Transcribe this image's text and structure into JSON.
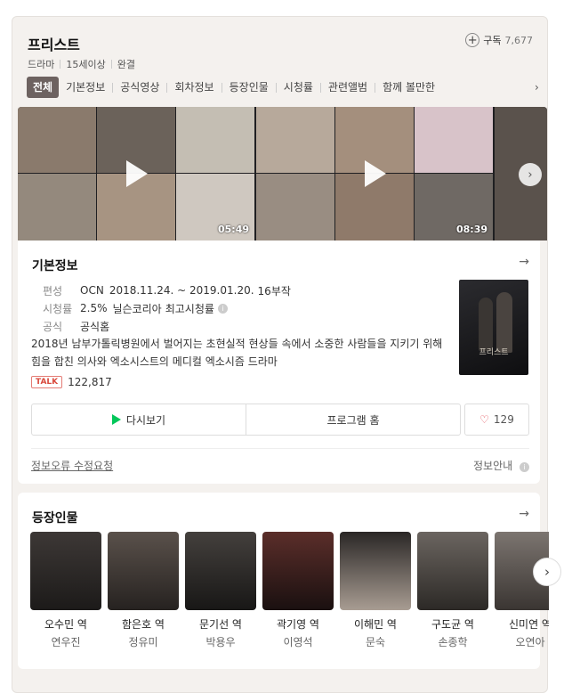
{
  "header": {
    "title": "프리스트",
    "subscribe_label": "구독",
    "subscribe_count": "7,677",
    "meta": [
      "드라마",
      "15세이상",
      "완결"
    ]
  },
  "tabs": [
    "전체",
    "기본정보",
    "공식영상",
    "회차정보",
    "등장인물",
    "시청률",
    "관련앨범",
    "함께 볼만한"
  ],
  "videos": [
    {
      "duration": "05:49"
    },
    {
      "duration": "08:39"
    }
  ],
  "basic_info": {
    "section_title": "기본정보",
    "rows": {
      "schedule_label": "편성",
      "channel": "OCN",
      "period": "2018.11.24. ~ 2019.01.20.",
      "episodes": "16부작",
      "rating_label": "시청률",
      "rating_value": "2.5%",
      "rating_source": "닐슨코리아",
      "rating_desc": "최고시청률",
      "official_label": "공식",
      "official_link": "공식홈"
    },
    "description": "2018년 남부가톨릭병원에서 벌어지는 초현실적 현상들 속에서 소중한 사람들을 지키기 위해 힘을 합친 의사와 엑소시스트의 메디컬 엑소시즘 드라마",
    "talk_badge": "TALK",
    "talk_count": "122,817",
    "buttons": {
      "watch": "다시보기",
      "home": "프로그램 홈",
      "like_count": "129"
    },
    "footer": {
      "error_report": "정보오류 수정요청",
      "info_guide": "정보안내"
    },
    "poster_title": "프리스트"
  },
  "cast": {
    "section_title": "등장인물",
    "members": [
      {
        "role": "오수민 역",
        "actor": "연우진"
      },
      {
        "role": "함은호 역",
        "actor": "정유미"
      },
      {
        "role": "문기선 역",
        "actor": "박용우"
      },
      {
        "role": "곽기영 역",
        "actor": "이영석"
      },
      {
        "role": "이해민 역",
        "actor": "문숙"
      },
      {
        "role": "구도균 역",
        "actor": "손종학"
      },
      {
        "role": "신미연 역",
        "actor": "오연아"
      }
    ]
  },
  "colors": {
    "active_tab": "#6d6260",
    "accent_green": "#03a94d",
    "link_blue": "#1a5fb4",
    "rating_red": "#e0414b"
  }
}
